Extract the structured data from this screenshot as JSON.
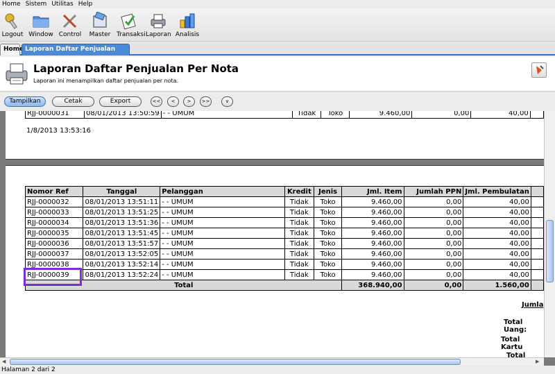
{
  "menubar": {
    "items": [
      "Home",
      "Sistem",
      "Utilitas",
      "Help"
    ]
  },
  "toolbar": {
    "buttons": [
      {
        "label": "Logout",
        "icon": "key-icon"
      },
      {
        "label": "Window",
        "icon": "folder-icon"
      },
      {
        "label": "Control",
        "icon": "tools-icon"
      },
      {
        "label": "Master",
        "icon": "master-icon"
      },
      {
        "label": "Transaksi",
        "icon": "transaction-icon"
      },
      {
        "label": "Laporan",
        "icon": "report-icon"
      },
      {
        "label": "Analisis",
        "icon": "analysis-icon"
      }
    ]
  },
  "tabs": {
    "home": "Home",
    "active": "Laporan Daftar Penjualan Per Nota"
  },
  "header": {
    "title": "Laporan Daftar Penjualan Per Nota",
    "subtitle": "Laporan ini menampilkan daftar penjualan per nota."
  },
  "report_toolbar": {
    "tampilkan": "Tampilkan",
    "cetak": "Cetak",
    "export": "Export",
    "first": "<<",
    "prev": "<",
    "next": ">",
    "last": ">>",
    "down": "v"
  },
  "page1": {
    "partial_row": [
      "RJJ-0000031",
      "08/01/2013 13:50:59",
      "- - UMUM",
      "Tidak",
      "Toko",
      "9.460,00",
      "0,00",
      "40,00"
    ],
    "timestamp": "1/8/2013 13:53:16"
  },
  "table": {
    "headers": [
      "Nomor Ref",
      "Tanggal",
      "Pelanggan",
      "Kredit",
      "Jenis",
      "Jml. Item",
      "Jumlah PPN",
      "Jml. Pembulatan"
    ],
    "rows": [
      [
        "RJJ-0000032",
        "08/01/2013 13:51:11",
        "- - UMUM",
        "Tidak",
        "Toko",
        "9.460,00",
        "0,00",
        "40,00"
      ],
      [
        "RJJ-0000033",
        "08/01/2013 13:51:25",
        "- - UMUM",
        "Tidak",
        "Toko",
        "9.460,00",
        "0,00",
        "40,00"
      ],
      [
        "RJJ-0000034",
        "08/01/2013 13:51:36",
        "- - UMUM",
        "Tidak",
        "Toko",
        "9.460,00",
        "0,00",
        "40,00"
      ],
      [
        "RJJ-0000035",
        "08/01/2013 13:51:45",
        "- - UMUM",
        "Tidak",
        "Toko",
        "9.460,00",
        "0,00",
        "40,00"
      ],
      [
        "RJJ-0000036",
        "08/01/2013 13:51:57",
        "- - UMUM",
        "Tidak",
        "Toko",
        "9.460,00",
        "0,00",
        "40,00"
      ],
      [
        "RJJ-0000037",
        "08/01/2013 13:52:05",
        "- - UMUM",
        "Tidak",
        "Toko",
        "9.460,00",
        "0,00",
        "40,00"
      ],
      [
        "RJJ-0000038",
        "08/01/2013 13:52:14",
        "- - UMUM",
        "Tidak",
        "Toko",
        "9.460,00",
        "0,00",
        "40,00"
      ],
      [
        "RJJ-0000039",
        "08/01/2013 13:52:24",
        "- - UMUM",
        "Tidak",
        "Toko",
        "9.460,00",
        "0,00",
        "40,00"
      ]
    ],
    "total_label": "Total",
    "total_item": "368.940,00",
    "total_ppn": "0,00",
    "total_pembulatan": "1.560,00"
  },
  "summary": {
    "jumlah": "Jumla",
    "total_uang": "Total Uang:",
    "total_kartu_1": "Total Kartu",
    "total_kartu_2": "Total Kartu"
  },
  "status": {
    "text": "Halaman 2 dari 2"
  },
  "colors": {
    "tab_active": "#4a8ad6",
    "highlight": "#7a2fd6"
  }
}
